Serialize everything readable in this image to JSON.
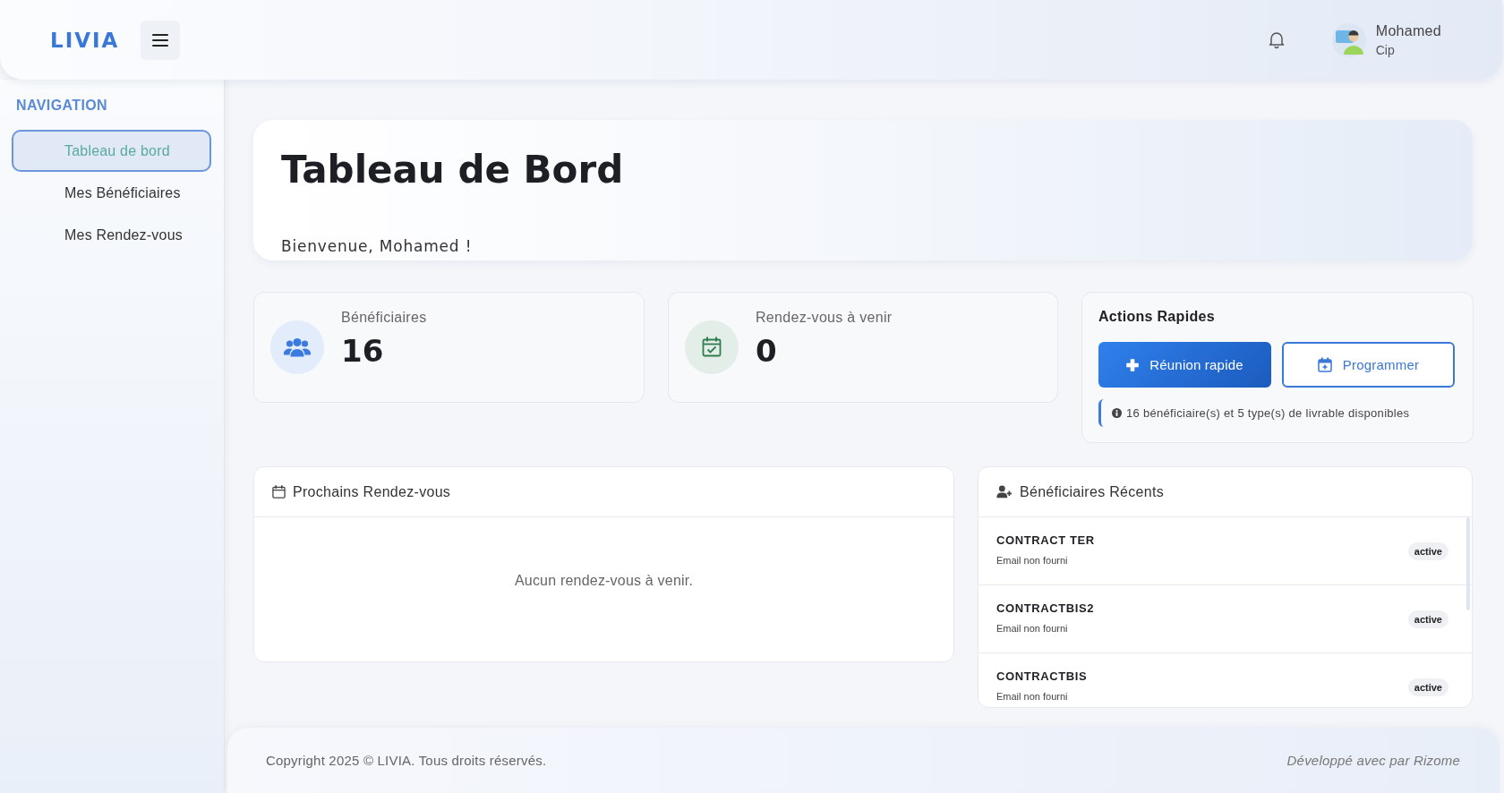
{
  "header": {
    "logo": "LIVIA",
    "user": {
      "name": "Mohamed",
      "role": "Cip"
    }
  },
  "sidebar": {
    "heading": "NAVIGATION",
    "items": [
      {
        "label": "Tableau de bord",
        "selected": true
      },
      {
        "label": "Mes Bénéficiaires",
        "selected": false
      },
      {
        "label": "Mes Rendez-vous",
        "selected": false
      }
    ]
  },
  "page": {
    "title": "Tableau de Bord",
    "welcome": "Bienvenue, Mohamed !"
  },
  "stats": [
    {
      "kind": "beneficiaries",
      "label": "Bénéficiaires",
      "value": "16"
    },
    {
      "kind": "appointments",
      "label": "Rendez-vous à venir",
      "value": "0"
    }
  ],
  "quick_actions": {
    "title": "Actions Rapides",
    "buttons": [
      {
        "kind": "primary",
        "label": "Réunion rapide"
      },
      {
        "kind": "outline",
        "label": "Programmer"
      }
    ],
    "note": "16 bénéficiaire(s) et 5 type(s) de livrable disponibles"
  },
  "upcoming": {
    "title": "Prochains Rendez-vous",
    "empty_message": "Aucun rendez-vous à venir."
  },
  "recent_beneficiaries": {
    "title": "Bénéficiaires Récents",
    "rows": [
      {
        "name": "CONTRACT TER",
        "email": "Email non fourni",
        "status": "active"
      },
      {
        "name": "CONTRACTBIS2",
        "email": "Email non fourni",
        "status": "active"
      },
      {
        "name": "CONTRACTBIS",
        "email": "Email non fourni",
        "status": "active"
      }
    ]
  },
  "footer": {
    "copyright": "Copyright 2025 © LIVIA. Tous droits réservés.",
    "credit": "Développé avec par Rizome"
  }
}
